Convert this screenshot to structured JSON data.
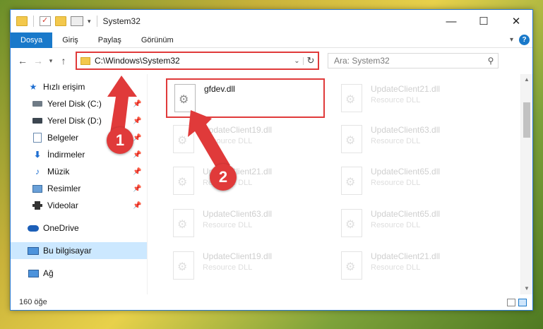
{
  "window": {
    "title": "System32",
    "controls": {
      "minimize": "—",
      "maximize": "☐",
      "close": "✕"
    }
  },
  "ribbon": {
    "tabs": [
      "Dosya",
      "Giriş",
      "Paylaş",
      "Görünüm"
    ],
    "expand_icon": "chevron-down-icon",
    "help_label": "?"
  },
  "navbar": {
    "back": "←",
    "forward": "→",
    "recent": "▾",
    "up": "↑",
    "address": "C:\\Windows\\System32",
    "search_placeholder": "Ara: System32"
  },
  "sidebar": {
    "items": [
      {
        "label": "Hızlı erişim",
        "icon": "star-icon"
      },
      {
        "label": "Yerel Disk (C:)",
        "icon": "drive-icon",
        "pinned": true
      },
      {
        "label": "Yerel Disk (D:)",
        "icon": "drive-icon",
        "pinned": true
      },
      {
        "label": "Belgeler",
        "icon": "documents-icon",
        "pinned": true
      },
      {
        "label": "İndirmeler",
        "icon": "download-icon",
        "pinned": true
      },
      {
        "label": "Müzik",
        "icon": "music-icon",
        "pinned": true
      },
      {
        "label": "Resimler",
        "icon": "pictures-icon",
        "pinned": true
      },
      {
        "label": "Videolar",
        "icon": "videos-icon",
        "pinned": true
      },
      {
        "label": "OneDrive",
        "icon": "onedrive-icon"
      },
      {
        "label": "Bu bilgisayar",
        "icon": "computer-icon",
        "selected": true
      },
      {
        "label": "Ağ",
        "icon": "network-icon"
      }
    ]
  },
  "files": [
    {
      "name": "gfdev.dll",
      "type": "",
      "highlight": true
    },
    {
      "name": "UpdateClient21.dll",
      "type": "Resource DLL"
    },
    {
      "name": "UpdateClient19.dll",
      "type": "Resource DLL"
    },
    {
      "name": "UpdateClient63.dll",
      "type": "Resource DLL"
    },
    {
      "name": "UpdateClient21.dll",
      "type": "Resource DLL"
    },
    {
      "name": "UpdateClient65.dll",
      "type": "Resource DLL"
    },
    {
      "name": "UpdateClient63.dll",
      "type": "Resource DLL"
    },
    {
      "name": "UpdateClient65.dll",
      "type": "Resource DLL"
    },
    {
      "name": "UpdateClient19.dll",
      "type": "Resource DLL"
    },
    {
      "name": "UpdateClient21.dll",
      "type": "Resource DLL"
    }
  ],
  "status": {
    "count": "160 öğe"
  },
  "annotations": {
    "step1": "1",
    "step2": "2"
  },
  "colors": {
    "accent": "#1979ca",
    "highlight": "#e03a3a",
    "selection": "#cce8ff"
  }
}
